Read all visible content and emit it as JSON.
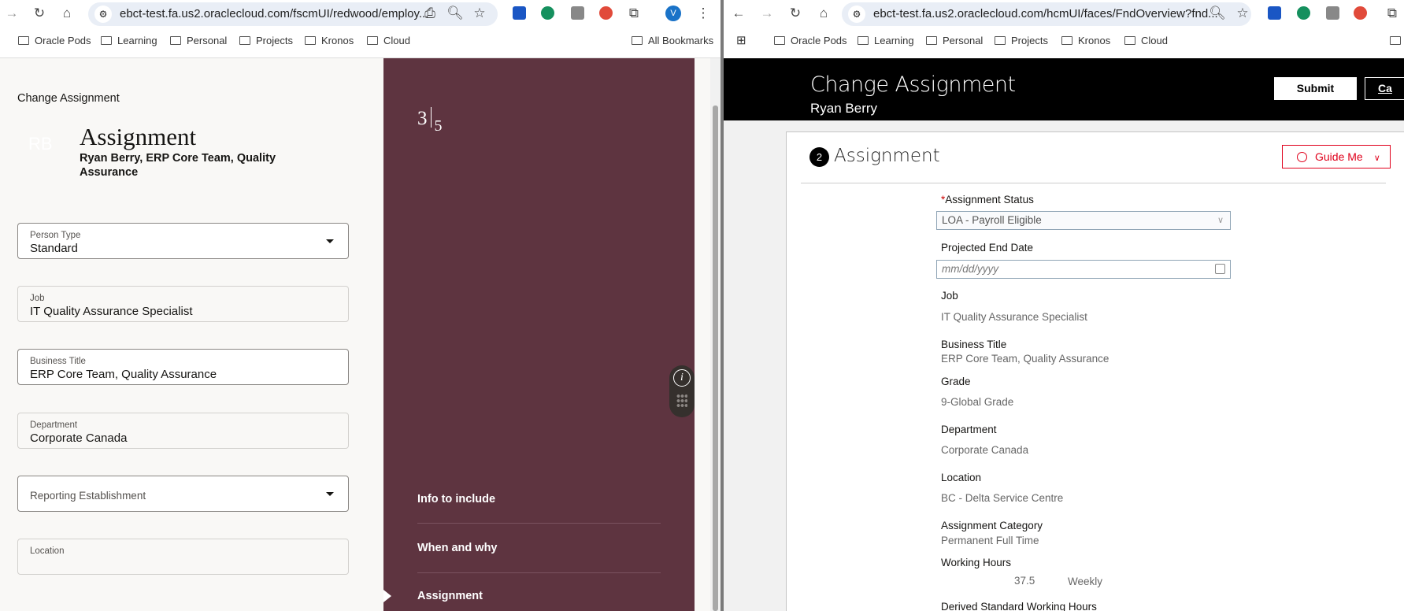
{
  "left_window": {
    "url": "ebct-test.fa.us2.oraclecloud.com/fscmUI/redwood/employ...",
    "profile_initial": "V",
    "bookmarks": [
      "Oracle Pods",
      "Learning",
      "Personal",
      "Projects",
      "Kronos",
      "Cloud"
    ],
    "all_bookmarks": "All Bookmarks",
    "page": {
      "breadcrumb": "Change Assignment",
      "avatar_initials": "RB",
      "title": "Assignment",
      "subtitle": "Ryan Berry, ERP Core Team, Quality Assurance",
      "fields": [
        {
          "label": "Person Type",
          "value": "Standard"
        },
        {
          "label": "Job",
          "value": "IT Quality Assurance Specialist"
        },
        {
          "label": "Business Title",
          "value": "ERP Core Team, Quality Assurance"
        },
        {
          "label": "Department",
          "value": "Corporate Canada"
        },
        {
          "label": "Reporting Establishment",
          "value": ""
        },
        {
          "label": "Location",
          "value": ""
        }
      ],
      "step_current": "3",
      "step_total": "5",
      "steps": [
        "Info to include",
        "When and why",
        "Assignment"
      ],
      "panel_color": "#5e3440"
    }
  },
  "right_window": {
    "url": "ebct-test.fa.us2.oraclecloud.com/hcmUI/faces/FndOverview?fnd...",
    "bookmarks": [
      "Oracle Pods",
      "Learning",
      "Personal",
      "Projects",
      "Kronos",
      "Cloud"
    ],
    "header": {
      "title": "Change Assignment",
      "subtitle": "Ryan Berry",
      "submit": "Submit",
      "cancel": "Ca"
    },
    "section": {
      "number": "2",
      "title": "Assignment",
      "guide_me": "Guide Me"
    },
    "form": {
      "required_mark": "*",
      "assignment_status_label": "Assignment Status",
      "assignment_status_value": "LOA - Payroll Eligible",
      "projected_end_label": "Projected End Date",
      "projected_end_placeholder": "mm/dd/yyyy",
      "fields": [
        {
          "label": "Job",
          "value": "IT Quality Assurance Specialist"
        },
        {
          "label": "Business Title",
          "value": "ERP Core Team, Quality Assurance"
        },
        {
          "label": "Grade",
          "value": "9-Global Grade"
        },
        {
          "label": "Department",
          "value": "Corporate Canada"
        },
        {
          "label": "Location",
          "value": "BC - Delta Service Centre"
        },
        {
          "label": "Assignment Category",
          "value": "Permanent Full Time"
        }
      ],
      "working_hours_label": "Working Hours",
      "working_hours_value": "37.5",
      "working_hours_frequency": "Weekly",
      "derived_label": "Derived Standard Working Hours"
    }
  }
}
